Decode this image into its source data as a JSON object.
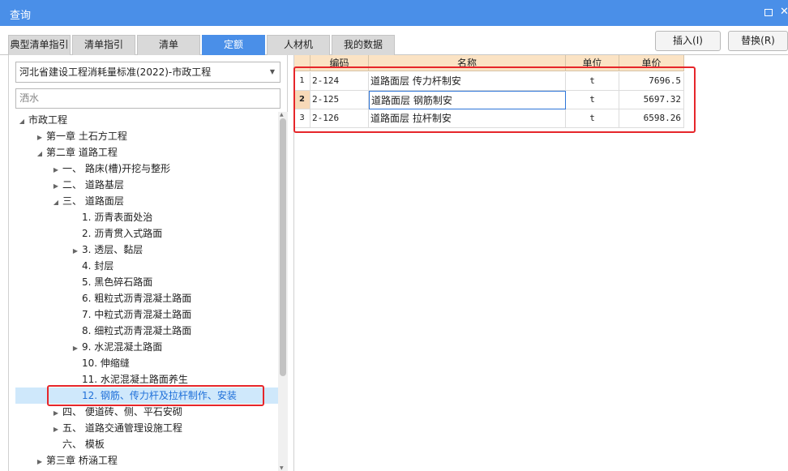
{
  "window": {
    "title": "查询",
    "maximize_icon": "maximize-icon",
    "close_icon": "close-icon",
    "close_glyph": "✕"
  },
  "tabs": [
    {
      "label": "典型清单指引",
      "active": false
    },
    {
      "label": "清单指引",
      "active": false
    },
    {
      "label": "清单",
      "active": false
    },
    {
      "label": "定额",
      "active": true
    },
    {
      "label": "人材机",
      "active": false
    },
    {
      "label": "我的数据",
      "active": false
    }
  ],
  "toolbar": {
    "insert_label": "插入(I)",
    "replace_label": "替换(R)"
  },
  "left": {
    "quota_library": "河北省建设工程消耗量标准(2022)-市政工程",
    "search_value": "洒水",
    "tree": [
      {
        "label": "市政工程",
        "level": 0,
        "expander": "expanded",
        "selected": false
      },
      {
        "label": "第一章 土石方工程",
        "level": 1,
        "expander": "collapsed",
        "selected": false
      },
      {
        "label": "第二章 道路工程",
        "level": 1,
        "expander": "expanded",
        "selected": false
      },
      {
        "label": "一、 路床(槽)开挖与整形",
        "level": 2,
        "expander": "collapsed",
        "selected": false
      },
      {
        "label": "二、 道路基层",
        "level": 2,
        "expander": "collapsed",
        "selected": false
      },
      {
        "label": "三、 道路面层",
        "level": 2,
        "expander": "expanded",
        "selected": false
      },
      {
        "label": "1. 沥青表面处治",
        "level": 3,
        "expander": "none",
        "selected": false
      },
      {
        "label": "2. 沥青贯入式路面",
        "level": 3,
        "expander": "none",
        "selected": false
      },
      {
        "label": "3. 透层、黏层",
        "level": 3,
        "expander": "collapsed",
        "selected": false
      },
      {
        "label": "4. 封层",
        "level": 3,
        "expander": "none",
        "selected": false
      },
      {
        "label": "5. 黑色碎石路面",
        "level": 3,
        "expander": "none",
        "selected": false
      },
      {
        "label": "6. 粗粒式沥青混凝土路面",
        "level": 3,
        "expander": "none",
        "selected": false
      },
      {
        "label": "7. 中粒式沥青混凝土路面",
        "level": 3,
        "expander": "none",
        "selected": false
      },
      {
        "label": "8. 细粒式沥青混凝土路面",
        "level": 3,
        "expander": "none",
        "selected": false
      },
      {
        "label": "9. 水泥混凝土路面",
        "level": 3,
        "expander": "collapsed",
        "selected": false
      },
      {
        "label": "10. 伸缩缝",
        "level": 3,
        "expander": "none",
        "selected": false
      },
      {
        "label": "11. 水泥混凝土路面养生",
        "level": 3,
        "expander": "none",
        "selected": false
      },
      {
        "label": "12. 钢筋、传力杆及拉杆制作、安装",
        "level": 3,
        "expander": "none",
        "selected": true
      },
      {
        "label": "四、 便道砖、侧、平石安砌",
        "level": 2,
        "expander": "collapsed",
        "selected": false
      },
      {
        "label": "五、 道路交通管理设施工程",
        "level": 2,
        "expander": "collapsed",
        "selected": false
      },
      {
        "label": "六、 模板",
        "level": 2,
        "expander": "none",
        "selected": false
      },
      {
        "label": "第三章 桥涵工程",
        "level": 1,
        "expander": "collapsed",
        "selected": false
      }
    ]
  },
  "grid": {
    "columns": [
      "编码",
      "名称",
      "单位",
      "单价"
    ],
    "rows": [
      {
        "no": "1",
        "code": "2-124",
        "name": "道路面层 传力杆制安",
        "unit": "t",
        "price": "7696.5"
      },
      {
        "no": "2",
        "code": "2-125",
        "name": "道路面层 钢筋制安",
        "unit": "t",
        "price": "5697.32"
      },
      {
        "no": "3",
        "code": "2-126",
        "name": "道路面层 拉杆制安",
        "unit": "t",
        "price": "6598.26"
      }
    ],
    "current_row": 1
  },
  "colors": {
    "accent": "#4a8fe8",
    "highlight_box": "#e6262a",
    "selected_tree_bg": "#cfe8fb",
    "selected_tree_text": "#1e6fd9",
    "grid_header_bg": "#fbe3c4"
  }
}
